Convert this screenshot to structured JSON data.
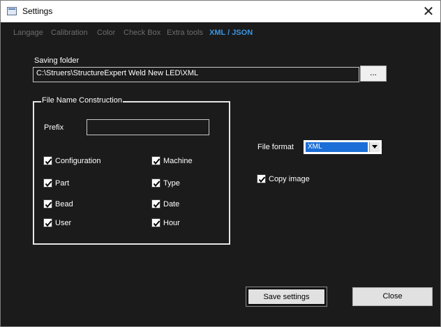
{
  "window": {
    "title": "Settings"
  },
  "tabs": [
    {
      "label": "Langage"
    },
    {
      "label": "Calibration"
    },
    {
      "label": "Color"
    },
    {
      "label": "Check Box"
    },
    {
      "label": "Extra tools"
    },
    {
      "label": "XML / JSON",
      "active": true
    }
  ],
  "saving_folder": {
    "label": "Saving folder",
    "value": "C:\\Struers\\StructureExpert Weld New LED\\XML",
    "browse_label": "..."
  },
  "file_name_construction": {
    "legend": "File Name Construction",
    "prefix_label": "Prefix",
    "prefix_value": "",
    "options": [
      {
        "label": "Configuration",
        "checked": true
      },
      {
        "label": "Machine",
        "checked": true
      },
      {
        "label": "Part",
        "checked": true
      },
      {
        "label": "Type",
        "checked": true
      },
      {
        "label": "Bead",
        "checked": true
      },
      {
        "label": "Date",
        "checked": true
      },
      {
        "label": "User",
        "checked": true
      },
      {
        "label": "Hour",
        "checked": true
      }
    ]
  },
  "file_format": {
    "label": "File format",
    "selected": "XML"
  },
  "copy_image": {
    "label": "Copy image",
    "checked": true
  },
  "buttons": {
    "save": "Save settings",
    "close": "Close"
  },
  "colors": {
    "background": "#1b1b1b",
    "active_tab": "#3b95e0",
    "inactive_tab": "#6d6d6d",
    "selection": "#1d6ed6"
  }
}
